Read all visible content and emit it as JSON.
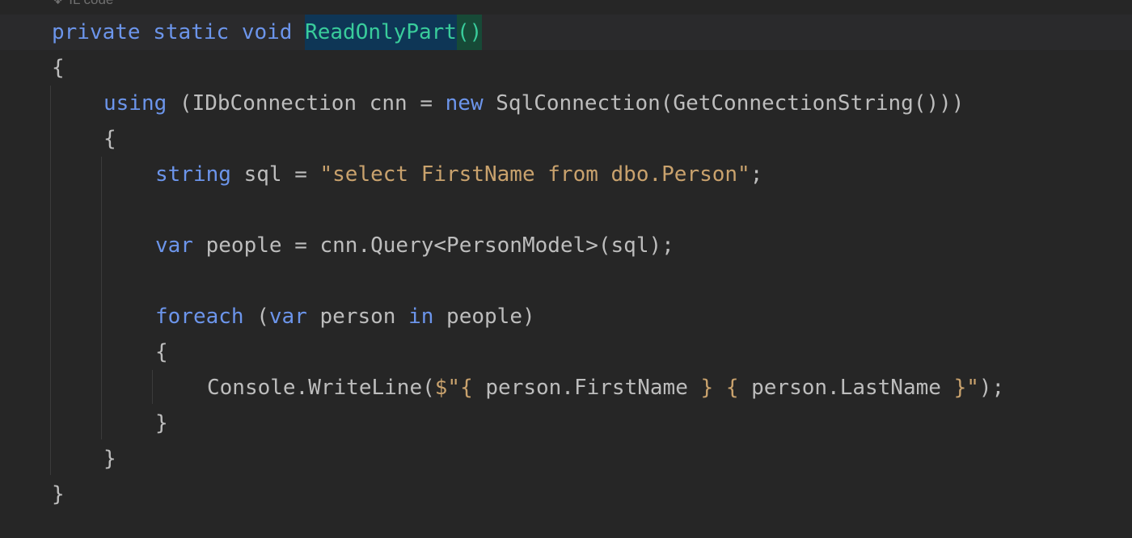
{
  "editor": {
    "code_vision_hint": "IL code",
    "lines": {
      "l1": {
        "kw1": "private",
        "kw2": "static",
        "kw3": "void",
        "method": "ReadOnlyPart",
        "parens": "()"
      },
      "l2": {
        "text": "{"
      },
      "l3": {
        "kw_using": "using",
        "p1": " (IDbConnection cnn = ",
        "kw_new": "new",
        "p2": " SqlConnection(GetConnectionString()))"
      },
      "l4": {
        "text": "{"
      },
      "l5": {
        "kw_string": "string",
        "p1": " sql = ",
        "str": "\"select FirstName from dbo.Person\"",
        "p2": ";"
      },
      "l6": {
        "kw_var": "var",
        "p1": " people = cnn.Query<PersonModel>(sql);"
      },
      "l7": {
        "kw_foreach": "foreach",
        "p1": " (",
        "kw_var": "var",
        "p2": " person ",
        "kw_in": "in",
        "p3": " people)"
      },
      "l8": {
        "text": "{"
      },
      "l9": {
        "p1": "Console.WriteLine(",
        "str_open": "$\"",
        "brace1_open": "{",
        "expr1": " person.FirstName ",
        "brace1_close": "}",
        "space": " ",
        "brace2_open": "{",
        "expr2": " person.LastName ",
        "brace2_close": "}",
        "str_close": "\"",
        "p2": ");"
      },
      "l10": {
        "text": "}"
      },
      "l11": {
        "text": "}"
      },
      "l12": {
        "text": "}"
      }
    }
  },
  "colors": {
    "background": "#262626",
    "keyword": "#6c95eb",
    "method": "#39cc9b",
    "string": "#c9a26d",
    "plain": "#bdbdbd"
  }
}
